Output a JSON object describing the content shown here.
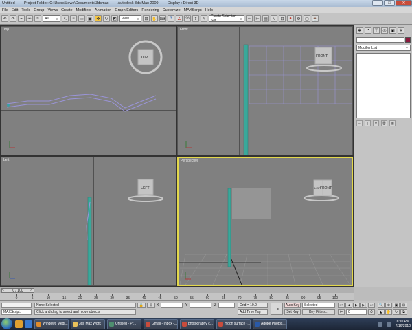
{
  "window": {
    "title_app": "Untitled",
    "title_project": "- Project Folder: C:\\Users\\Lowe\\Documents\\3dsmax",
    "title_product": "- Autodesk 3ds Max  2009",
    "title_display": "- Display : Direct 3D"
  },
  "menu": [
    "File",
    "Edit",
    "Tools",
    "Group",
    "Views",
    "Create",
    "Modifiers",
    "Animation",
    "Graph Editors",
    "Rendering",
    "Customize",
    "MAXScript",
    "Help"
  ],
  "toolbar": {
    "filter_value": "All",
    "refcoord_value": "View",
    "selection_set_placeholder": "Create Selection Set"
  },
  "viewports": {
    "top": {
      "label": "Top",
      "cube_label": "TOP"
    },
    "front": {
      "label": "Front",
      "cube_label": "FRONT"
    },
    "left": {
      "label": "Left",
      "cube_label": "LEFT"
    },
    "perspective": {
      "label": "Perspective",
      "cube_label_1": "FRONT",
      "cube_label_2": "LEFT"
    }
  },
  "command_panel": {
    "modifier_list": "Modifier List"
  },
  "timeline": {
    "frame_display": "0 / 100",
    "ticks": [
      "0",
      "5",
      "10",
      "15",
      "20",
      "25",
      "30",
      "35",
      "40",
      "45",
      "50",
      "55",
      "60",
      "65",
      "70",
      "75",
      "80",
      "85",
      "90",
      "95",
      "100"
    ]
  },
  "status": {
    "maxscript_label": "MAXScript.",
    "selection_status": "None Selected",
    "prompt": "Click and drag to select and move objects",
    "x_label": "X",
    "y_label": "Y",
    "z_label": "Z",
    "grid": "Grid = 10.0",
    "add_time_tag": "Add Time Tag",
    "auto_key": "Auto Key",
    "set_key": "Set Key",
    "selected_dropdown": "Selected",
    "key_filters": "Key Filters...",
    "frame_spinner": "0"
  },
  "taskbar": {
    "tasks": [
      {
        "label": "Windows Medi...",
        "color": "#e08b2a"
      },
      {
        "label": "3ds Max Work",
        "color": "#e9c15a"
      },
      {
        "label": "Untitled     - Pr...",
        "color": "#4e8f6f"
      },
      {
        "label": "Gmail - Inbox -...",
        "color": "#c94c3c"
      },
      {
        "label": "photography c...",
        "color": "#c94c3c"
      },
      {
        "label": "moon surface -...",
        "color": "#c94c3c"
      },
      {
        "label": "Adobe Photos...",
        "color": "#2a5aa8"
      }
    ],
    "time": "6:10 PM",
    "date": "7/16/2010"
  }
}
